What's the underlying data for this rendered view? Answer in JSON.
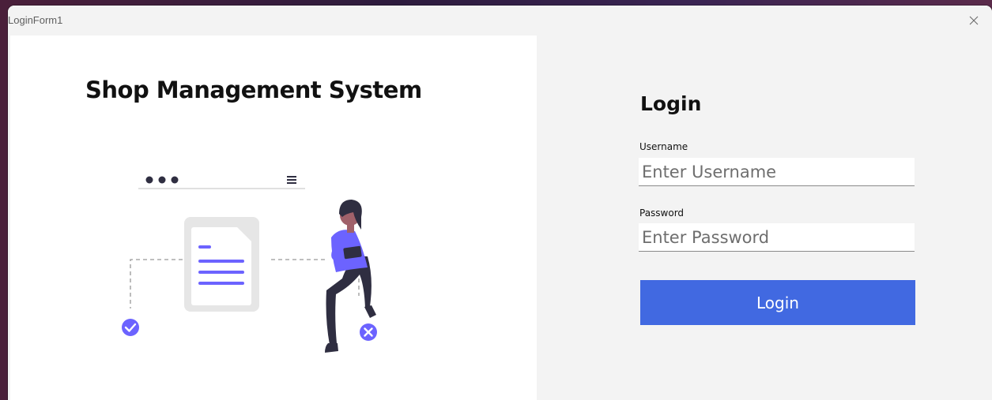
{
  "window": {
    "title": "LoginForm1",
    "close_icon": "close-icon"
  },
  "left": {
    "app_title": "Shop Management System"
  },
  "login": {
    "heading": "Login",
    "username_label": "Username",
    "username_placeholder": "Enter Username",
    "username_value": "",
    "password_label": "Password",
    "password_placeholder": "Enter Password",
    "password_value": "",
    "button_label": "Login"
  },
  "colors": {
    "accent": "#4169e1",
    "illustration_purple": "#6c63ff",
    "illustration_dark": "#2f2e41"
  }
}
